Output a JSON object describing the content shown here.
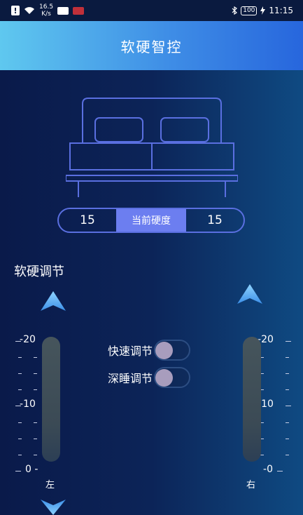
{
  "status_bar": {
    "net_speed_value": "16.5",
    "net_speed_unit": "K/s",
    "battery": "100",
    "time": "11:15",
    "icons": [
      "alert-icon",
      "wifi-icon",
      "app-badge-icon",
      "app-badge-icon",
      "bluetooth-icon",
      "battery-icon",
      "charging-icon"
    ]
  },
  "header": {
    "title": "软硬智控"
  },
  "hardness": {
    "left_value": "15",
    "label": "当前硬度",
    "right_value": "15"
  },
  "adjust": {
    "section_title": "软硬调节",
    "scale_labels": [
      "20",
      "10",
      "0"
    ],
    "left_label": "左",
    "right_label": "右",
    "left_level": 15,
    "right_level": 15,
    "scale_max": 20
  },
  "toggles": [
    {
      "label": "快速调节",
      "on": false
    },
    {
      "label": "深睡调节",
      "on": false
    }
  ],
  "colors": {
    "header_gradient_start": "#5fc8ef",
    "header_gradient_end": "#2766dd",
    "accent": "#6c7ef0",
    "bed_outline": "#5a6fe0"
  }
}
